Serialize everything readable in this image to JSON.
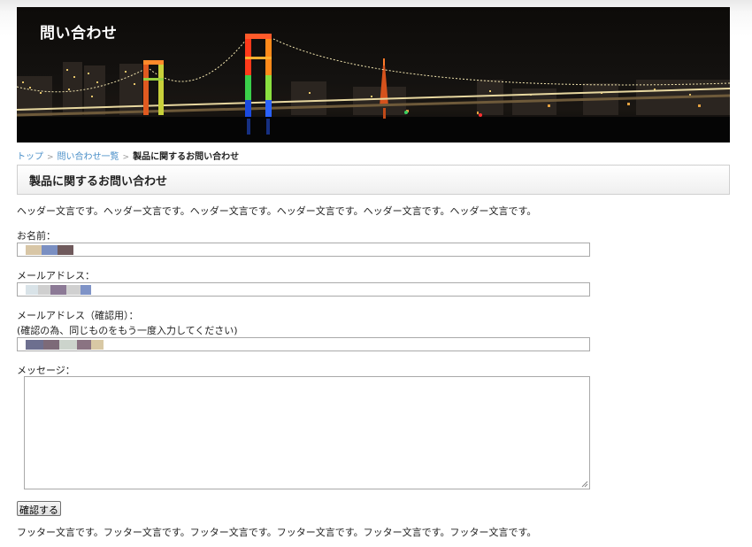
{
  "header": {
    "title": "問い合わせ"
  },
  "breadcrumb": {
    "items": [
      "トップ",
      "問い合わせ一覧"
    ],
    "current": "製品に関するお問い合わせ"
  },
  "page": {
    "heading": "製品に関するお問い合わせ",
    "header_text": "ヘッダー文言です。ヘッダー文言です。ヘッダー文言です。ヘッダー文言です。ヘッダー文言です。ヘッダー文言です。",
    "footer_text": "フッター文言です。フッター文言です。フッター文言です。フッター文言です。フッター文言です。フッター文言です。"
  },
  "form": {
    "name_label": "お名前：",
    "email_label": "メールアドレス：",
    "email_confirm_label": "メールアドレス（確認用）：",
    "email_confirm_note": "(確認の為、同じものをもう一度入力してください)",
    "message_label": "メッセージ：",
    "message_value": "",
    "confirm_button": "確認する",
    "redaction_colors": {
      "name": [
        "#d8c6a6",
        "#7a8fc2",
        "#6f5a5c"
      ],
      "email": [
        "#d9e3e8",
        "#cfcfcf",
        "#8c7a96",
        "#d0d0d0",
        "#7f93c7"
      ],
      "email_confirm": [
        "#6d6f8f",
        "#7d6a78",
        "#ccd4cc",
        "#8a7382",
        "#d8c8a4"
      ]
    }
  },
  "colors": {
    "link": "#4a8fc8",
    "heading_border": "#cfcfcf"
  }
}
